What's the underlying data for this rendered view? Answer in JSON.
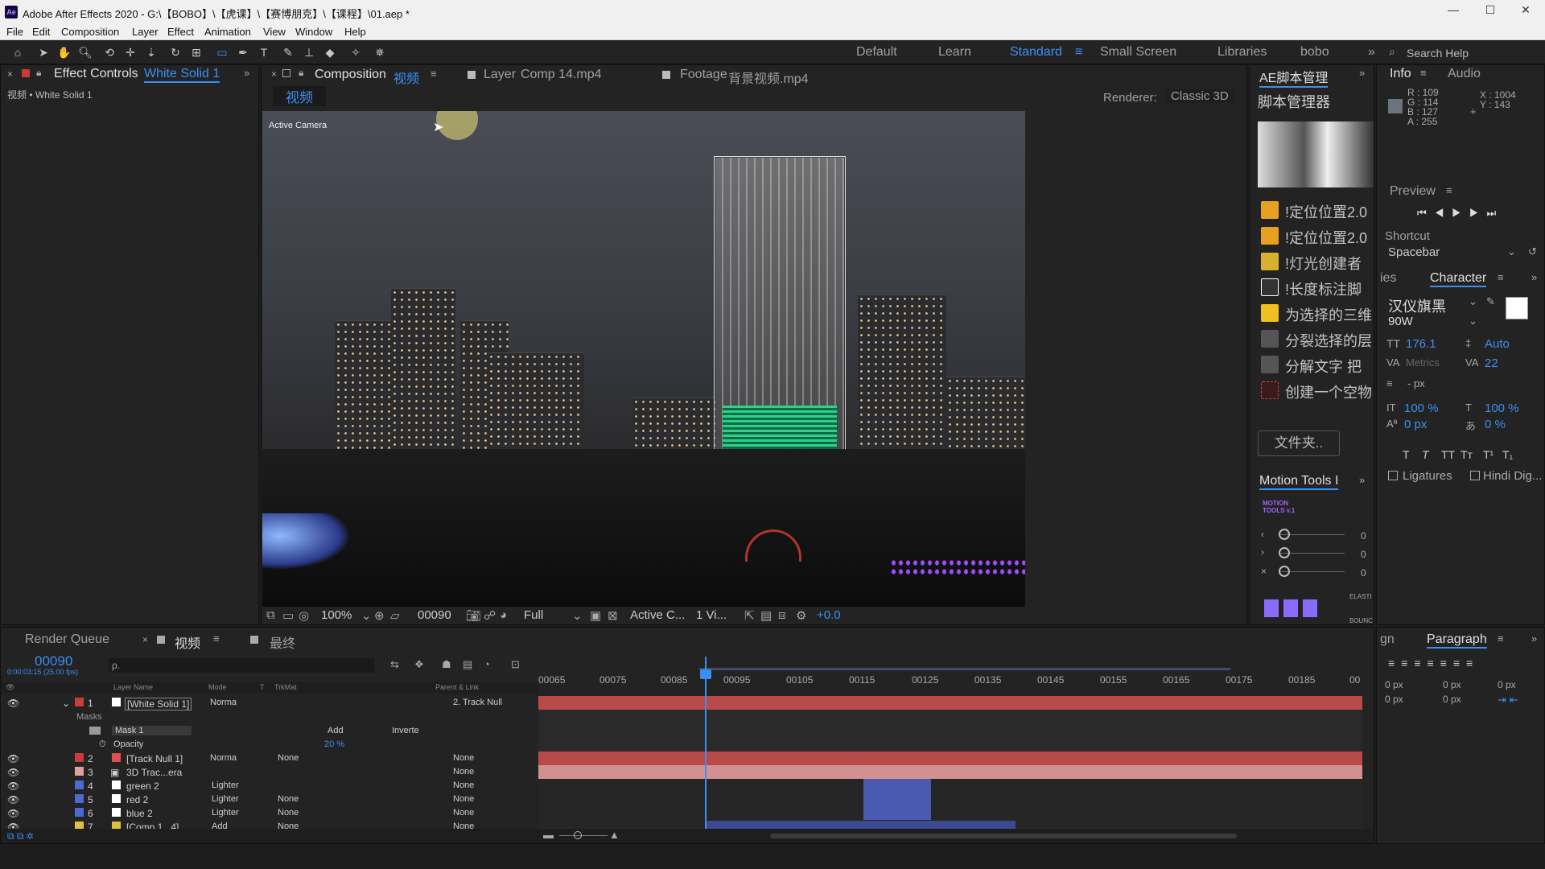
{
  "window": {
    "title": "Adobe After Effects 2020 - G:\\【BOBO】\\【虎课】\\【赛博朋克】\\【课程】\\01.aep *",
    "logo": "Ae",
    "controls": [
      "—",
      "☐",
      "✕"
    ]
  },
  "menu": [
    "File",
    "Edit",
    "Composition",
    "Layer",
    "Effect",
    "Animation",
    "View",
    "Window",
    "Help"
  ],
  "workspaces": {
    "items": [
      "Default",
      "Learn",
      "Standard",
      "Small Screen",
      "Libraries",
      "bobo"
    ],
    "active": "Standard",
    "search_placeholder": "Search Help"
  },
  "effect_controls": {
    "tab_label": "Effect Controls",
    "layer_name": "White Solid 1",
    "breadcrumb": "视频 • White Solid 1"
  },
  "comp_panel": {
    "tabs": [
      {
        "prefix": "Composition",
        "name": "视频"
      },
      {
        "prefix": "Layer",
        "name": "Comp 14.mp4"
      },
      {
        "prefix": "Footage",
        "name": "背景视频.mp4"
      }
    ],
    "subtab": "视频",
    "renderer_label": "Renderer:",
    "renderer_value": "Classic 3D",
    "camera_label": "Active Camera"
  },
  "viewer_controls": {
    "zoom": "100%",
    "timecode": "00090",
    "resolution": "Full",
    "view": "Active C...",
    "views": "1 Vi...",
    "exposure": "+0.0"
  },
  "scripts_panel": {
    "title": "AE脚本管理",
    "subtitle": "脚本管理器",
    "items": [
      {
        "label": "!定位位置2.0",
        "color": "#e8a020"
      },
      {
        "label": "!定位位置2.0",
        "color": "#e8a020"
      },
      {
        "label": "!灯光创建者",
        "color": "#d8b030"
      },
      {
        "label": "!长度标注脚",
        "color": "#ffffff"
      },
      {
        "label": "为选择的三维",
        "color": "#f0c020"
      },
      {
        "label": "分裂选择的层",
        "color": "#c8c8c8"
      },
      {
        "label": "分解文字 把",
        "color": "#c8c8c8"
      },
      {
        "label": "创建一个空物",
        "color": "#e04040"
      }
    ],
    "folder_button": "文件夹.."
  },
  "motion_tools": {
    "title": "Motion Tools I",
    "logo": "MOTION TOOLS v.1",
    "sliders": [
      {
        "icon": "‹",
        "value": "0"
      },
      {
        "icon": "›",
        "value": "0"
      },
      {
        "icon": "×",
        "value": "0"
      }
    ],
    "labels": [
      "ELASTI",
      "BOUNC"
    ]
  },
  "info_panel": {
    "tabs": [
      "Info",
      "Audio"
    ],
    "rgba": [
      "R : 109",
      "G : 114",
      "B : 127",
      "A : 255"
    ],
    "x": "X : 1004",
    "y": "Y : 143"
  },
  "preview_panel": {
    "title": "Preview",
    "shortcut_label": "Shortcut",
    "shortcut_value": "Spacebar"
  },
  "character_panel": {
    "tab_prefix": "ies",
    "title": "Character",
    "font": "汉仪旗黑",
    "weight": "90W",
    "size": "176.1",
    "leading": "Auto",
    "kerning": "Metrics",
    "tracking": "22",
    "unit": "- px",
    "vscale": "100 %",
    "hscale": "100 %",
    "baseline": "0 px",
    "tsume": "0 %",
    "styles": [
      "T",
      "T",
      "TT",
      "Tт",
      "T¹",
      "T₁"
    ],
    "ligatures": "Ligatures",
    "hindi": "Hindi Dig..."
  },
  "paragraph_panel": {
    "tab_prefix": "gn",
    "title": "Paragraph",
    "indent": [
      "0 px",
      "0 px",
      "0 px"
    ],
    "space": [
      "0 px",
      "0 px"
    ]
  },
  "timeline": {
    "tabs": [
      "Render Queue",
      "视频",
      "最终"
    ],
    "active_tab": "视频",
    "current_time": "00090",
    "time_sub": "0:00:03:15 (25.00 fps)",
    "search_placeholder": "ρ.",
    "columns": [
      "Layer Name",
      "Mode",
      "T",
      "TrkMat",
      "Parent & Link"
    ],
    "ruler": [
      "00065",
      "00075",
      "00085",
      "00095",
      "00105",
      "00115",
      "00125",
      "00135",
      "00145",
      "00155",
      "00165",
      "00175",
      "00185",
      "00"
    ],
    "layers": [
      {
        "num": "1",
        "name": "[White Solid 1]",
        "mode": "Norma",
        "trkmat": "",
        "parent": "2. Track Null",
        "color": "#c83c3c",
        "label_color": "#ffffff",
        "bar": "#b84a4a"
      },
      {
        "num": "2",
        "name": "[Track Null 1]",
        "mode": "Norma",
        "trkmat": "None",
        "parent": "None",
        "color": "#c83c3c",
        "label_color": "#e05050",
        "bar": "#b84a4a"
      },
      {
        "num": "3",
        "name": "3D Trac...era",
        "mode": "",
        "trkmat": "",
        "parent": "None",
        "color": "#e0a0a0",
        "label_color": "#e0a0a0",
        "bar": "#d29090"
      },
      {
        "num": "4",
        "name": "green 2",
        "mode": "Lighter",
        "trkmat": "",
        "parent": "None",
        "color": "#4a6bd0",
        "label_color": "#ffffff",
        "bar": "#4a5ab0"
      },
      {
        "num": "5",
        "name": "red 2",
        "mode": "Lighter",
        "trkmat": "None",
        "parent": "None",
        "color": "#4a6bd0",
        "label_color": "#ffffff",
        "bar": "#4a5ab0"
      },
      {
        "num": "6",
        "name": "blue 2",
        "mode": "Lighter",
        "trkmat": "None",
        "parent": "None",
        "color": "#4a6bd0",
        "label_color": "#ffffff",
        "bar": "#4a5ab0"
      },
      {
        "num": "7",
        "name": "[Comp 1...4]",
        "mode": "Add",
        "trkmat": "None",
        "parent": "None",
        "color": "#e0c040",
        "label_color": "#e0c040",
        "bar": "#4a5ab0"
      }
    ],
    "masks_label": "Masks",
    "mask_name": "Mask 1",
    "mask_mode": "Add",
    "mask_inverted": "Inverte",
    "opacity_label": "Opacity",
    "opacity_value": "20 %"
  }
}
